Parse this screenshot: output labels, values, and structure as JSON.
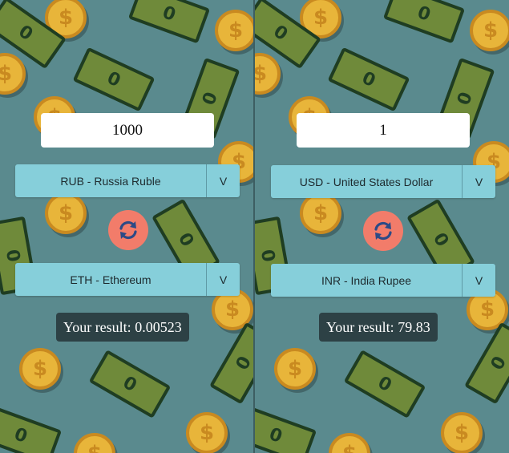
{
  "converters": [
    {
      "amount": "1000",
      "from_currency": "RUB - Russia Ruble",
      "to_currency": "ETH - Ethereum",
      "result_label": "Your result:",
      "result_value": "0.00523",
      "dropdown_glyph": "V"
    },
    {
      "amount": "1",
      "from_currency": "USD - United States Dollar",
      "to_currency": "INR - India Rupee",
      "result_label": "Your result:",
      "result_value": "79.83",
      "dropdown_glyph": "V"
    }
  ],
  "icons": {
    "swap": "swap-arrows-icon",
    "background_coin": "dollar-coin-icon",
    "background_bill": "banknote-icon"
  },
  "colors": {
    "background": "#5a8a8e",
    "select": "#86cfda",
    "swap_button": "#f27c6a",
    "coin": "#e8b53a",
    "bill": "#6f8a3a"
  }
}
